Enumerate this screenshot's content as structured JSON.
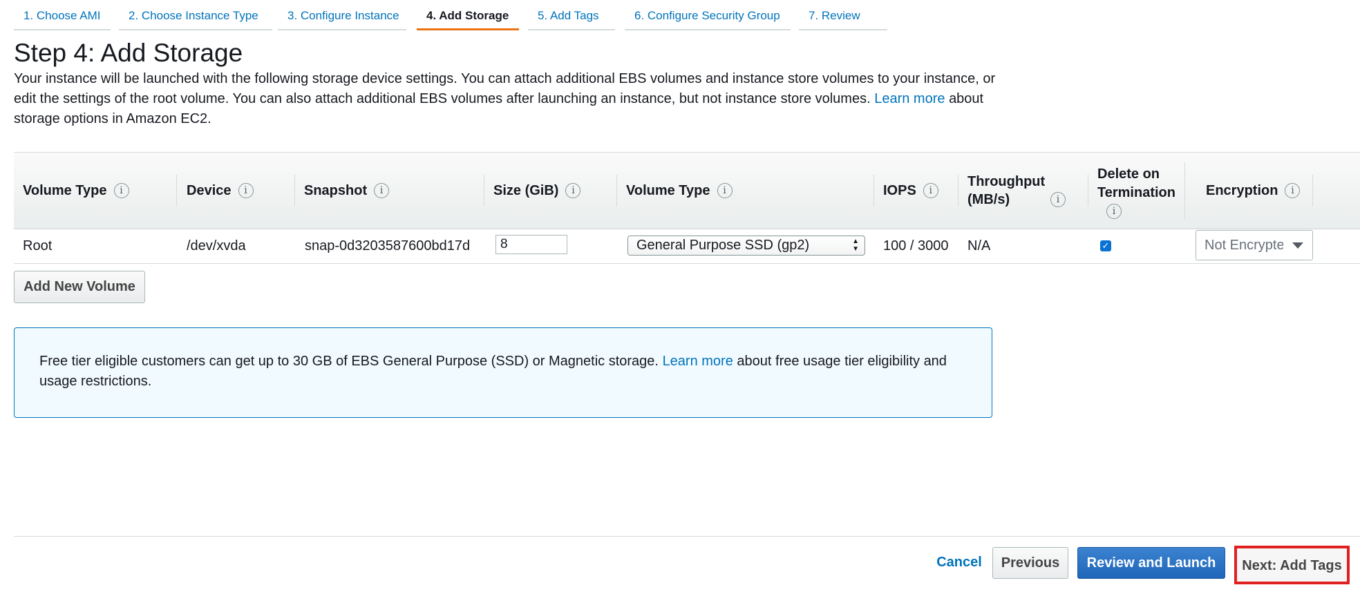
{
  "wizard": {
    "tabs": [
      {
        "label": "1. Choose AMI"
      },
      {
        "label": "2. Choose Instance Type"
      },
      {
        "label": "3. Configure Instance"
      },
      {
        "label": "4. Add Storage",
        "active": true
      },
      {
        "label": "5. Add Tags"
      },
      {
        "label": "6. Configure Security Group"
      },
      {
        "label": "7. Review"
      }
    ]
  },
  "page": {
    "title": "Step 4: Add Storage",
    "intro_text": "Your instance will be launched with the following storage device settings. You can attach additional EBS volumes and instance store volumes to your instance, or edit the settings of the root volume. You can also attach additional EBS volumes after launching an instance, but not instance store volumes.",
    "intro_link": "Learn more",
    "intro_suffix": "about storage options in Amazon EC2."
  },
  "table": {
    "columns": [
      {
        "label": "Volume Type"
      },
      {
        "label": "Device"
      },
      {
        "label": "Snapshot"
      },
      {
        "label": "Size (GiB)"
      },
      {
        "label": "Volume Type"
      },
      {
        "label": "IOPS"
      },
      {
        "label": "Throughput (MB/s)"
      },
      {
        "label": "Delete on Termination"
      },
      {
        "label": "Encryption"
      }
    ],
    "info_glyph": "i",
    "rows": [
      {
        "volume_type": "Root",
        "device": "/dev/xvda",
        "snapshot": "snap-0d3203587600bd17d",
        "size": "8",
        "ebs_volume_type": "General Purpose SSD (gp2)",
        "iops": "100 / 3000",
        "throughput": "N/A",
        "delete_on_termination": true,
        "encryption": "Not Encrypted"
      }
    ]
  },
  "buttons": {
    "add_volume": "Add New Volume",
    "cancel": "Cancel",
    "previous": "Previous",
    "review_launch": "Review and Launch",
    "next": "Next: Add Tags"
  },
  "notice": {
    "text": "Free tier eligible customers can get up to 30 GB of EBS General Purpose (SSD) or Magnetic storage.",
    "link": "Learn more",
    "suffix": "about free usage tier eligibility and usage restrictions."
  },
  "icons": {
    "info": "info-circle-icon",
    "checkbox": "checkmark-icon",
    "select_arrows": "up-down-arrows-icon",
    "dropdown": "caret-down-icon"
  },
  "colors": {
    "link": "#0073bb",
    "active_tab_underline": "#ec7211",
    "primary_button": "#1f66b9",
    "highlight_border": "#e02020",
    "notice_border": "#0073bb"
  }
}
